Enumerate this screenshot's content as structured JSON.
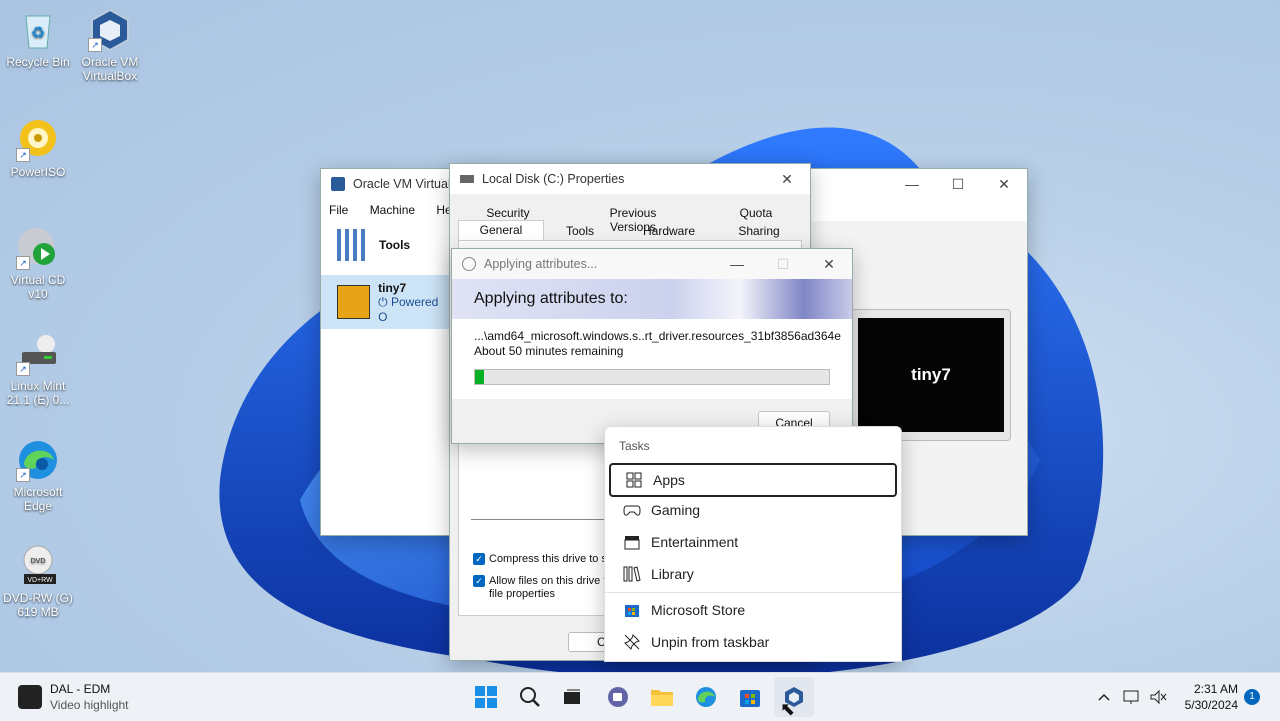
{
  "desktop": {
    "icons": [
      {
        "label": "Recycle Bin"
      },
      {
        "label": "Oracle VM VirtualBox"
      },
      {
        "label": "PowerISO"
      },
      {
        "label": "Virtual CD v10"
      },
      {
        "label": "Linux Mint 21.1 (E) 0..."
      },
      {
        "label": "Microsoft Edge"
      },
      {
        "label": "DVD-RW (G) 619 MB"
      }
    ]
  },
  "vbox": {
    "title": "Oracle VM VirtualB",
    "menu": [
      "File",
      "Machine",
      "Help"
    ],
    "tools_label": "Tools",
    "vm_name": "tiny7",
    "vm_state": "Powered O",
    "preview_label": "tiny7"
  },
  "props": {
    "title": "Local Disk (C:) Properties",
    "tabs_row1": [
      "Security",
      "Previous Versions",
      "Quota"
    ],
    "tabs_row2": [
      "General",
      "Tools",
      "Hardware",
      "Sharing"
    ],
    "compress_label": "Compress this drive to sa",
    "index_label": "Allow files on this drive to",
    "index_label2": "file properties",
    "ok_partial": "C"
  },
  "applying": {
    "title": "Applying attributes...",
    "heading": "Applying attributes to:",
    "file": "...\\amd64_microsoft.windows.s..rt_driver.resources_31bf3856ad364e",
    "remaining": "About 50 minutes remaining",
    "progress": 0.025,
    "cancel": "Cancel"
  },
  "jumplist": {
    "header": "Tasks",
    "items": [
      {
        "label": "Apps",
        "icon": "apps-icon"
      },
      {
        "label": "Gaming",
        "icon": "gamepad-icon"
      },
      {
        "label": "Entertainment",
        "icon": "clapper-icon"
      },
      {
        "label": "Library",
        "icon": "library-icon"
      }
    ],
    "store": "Microsoft Store",
    "unpin": "Unpin from taskbar"
  },
  "taskbar": {
    "widget_title": "DAL - EDM",
    "widget_sub": "Video highlight",
    "time": "2:31 AM",
    "date": "5/30/2024",
    "notif_count": "1"
  },
  "colors": {
    "accent": "#0067c0",
    "progress": "#06b025"
  }
}
